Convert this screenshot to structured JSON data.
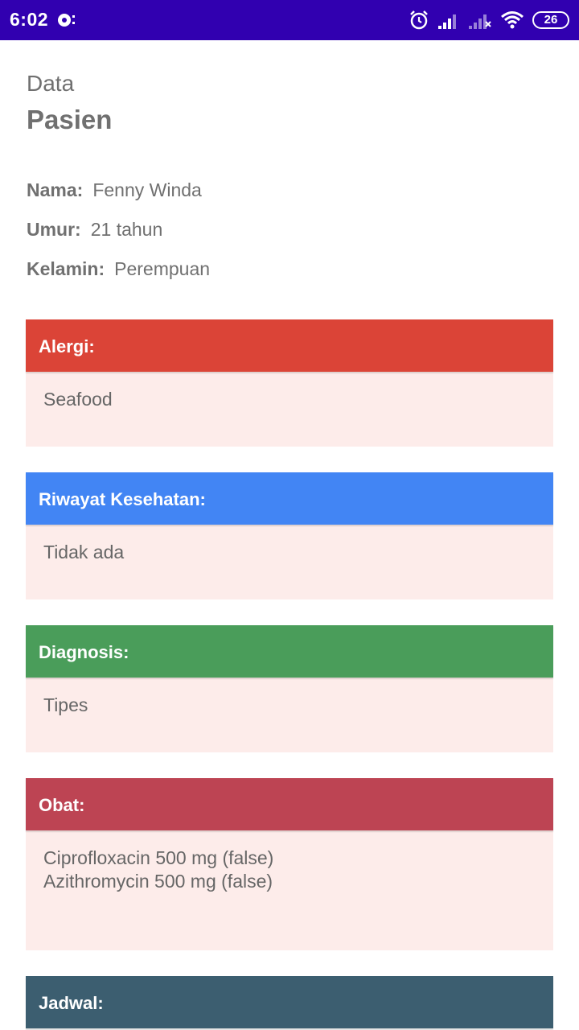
{
  "status_bar": {
    "time": "6:02",
    "battery_level": "26",
    "color": "#3100b0",
    "icons": [
      "notification-icon",
      "alarm-icon",
      "signal-icon",
      "signal-off-icon",
      "wifi-icon",
      "battery-icon"
    ]
  },
  "header": {
    "title_small": "Data",
    "title_big": "Pasien"
  },
  "patient": {
    "name_label": "Nama:",
    "name_value": "Fenny Winda",
    "age_label": "Umur:",
    "age_value": "21 tahun",
    "gender_label": "Kelamin:",
    "gender_value": "Perempuan"
  },
  "cards": {
    "allergy": {
      "title": "Alergi:",
      "content": "Seafood",
      "color": "#db4437"
    },
    "history": {
      "title": "Riwayat Kesehatan:",
      "content": "Tidak ada",
      "color": "#4285f4"
    },
    "diagnosis": {
      "title": "Diagnosis:",
      "content": "Tipes",
      "color": "#4a9d5a"
    },
    "medicine": {
      "title": "Obat:",
      "items": [
        "Ciprofloxacin 500 mg (false)",
        "Azithromycin 500 mg (false)"
      ],
      "color": "#bd4453"
    },
    "schedule": {
      "title": "Jadwal:",
      "color": "#3c5e70"
    }
  },
  "card_body_color": "#fdecea"
}
